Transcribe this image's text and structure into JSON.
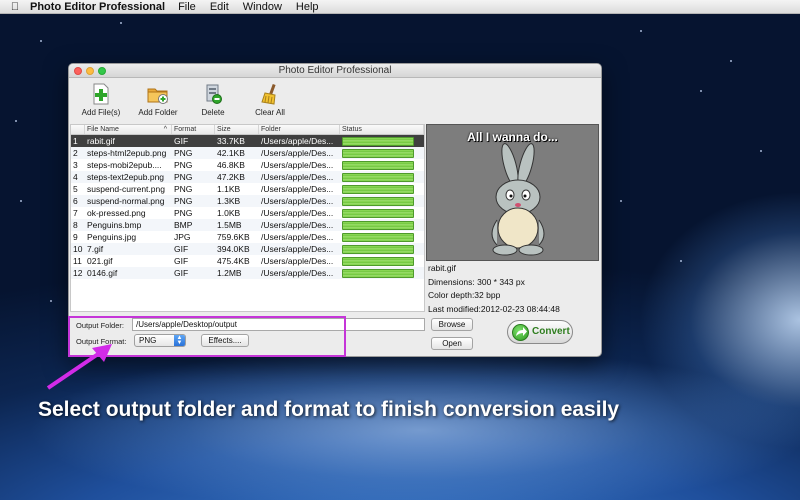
{
  "menubar": {
    "apple_icon": "apple-icon",
    "app_name": "Photo Editor Professional",
    "items": [
      "File",
      "Edit",
      "Window",
      "Help"
    ]
  },
  "window": {
    "title": "Photo Editor Professional"
  },
  "toolbar": {
    "add_files_label": "Add File(s)",
    "add_folder_label": "Add Folder",
    "delete_label": "Delete",
    "clear_all_label": "Clear All"
  },
  "file_table": {
    "columns": [
      "File Name",
      "Format",
      "Size",
      "Folder",
      "Status"
    ],
    "sort_indicator": "^",
    "rows": [
      {
        "num": "1",
        "name": "rabit.gif",
        "format": "GIF",
        "size": "33.7KB",
        "folder": "/Users/apple/Des...",
        "progress": 1.0
      },
      {
        "num": "2",
        "name": "steps-html2epub.png",
        "format": "PNG",
        "size": "42.1KB",
        "folder": "/Users/apple/Des...",
        "progress": 1.0
      },
      {
        "num": "3",
        "name": "steps-mobi2epub....",
        "format": "PNG",
        "size": "46.8KB",
        "folder": "/Users/apple/Des...",
        "progress": 1.0
      },
      {
        "num": "4",
        "name": "steps-text2epub.png",
        "format": "PNG",
        "size": "47.2KB",
        "folder": "/Users/apple/Des...",
        "progress": 1.0
      },
      {
        "num": "5",
        "name": "suspend-current.png",
        "format": "PNG",
        "size": "1.1KB",
        "folder": "/Users/apple/Des...",
        "progress": 1.0
      },
      {
        "num": "6",
        "name": "suspend-normal.png",
        "format": "PNG",
        "size": "1.3KB",
        "folder": "/Users/apple/Des...",
        "progress": 1.0
      },
      {
        "num": "7",
        "name": "ok-pressed.png",
        "format": "PNG",
        "size": "1.0KB",
        "folder": "/Users/apple/Des...",
        "progress": 1.0
      },
      {
        "num": "8",
        "name": "Penguins.bmp",
        "format": "BMP",
        "size": "1.5MB",
        "folder": "/Users/apple/Des...",
        "progress": 1.0
      },
      {
        "num": "9",
        "name": "Penguins.jpg",
        "format": "JPG",
        "size": "759.6KB",
        "folder": "/Users/apple/Des...",
        "progress": 1.0
      },
      {
        "num": "10",
        "name": "7.gif",
        "format": "GIF",
        "size": "394.0KB",
        "folder": "/Users/apple/Des...",
        "progress": 1.0
      },
      {
        "num": "11",
        "name": "021.gif",
        "format": "GIF",
        "size": "475.4KB",
        "folder": "/Users/apple/Des...",
        "progress": 1.0
      },
      {
        "num": "12",
        "name": "0146.gif",
        "format": "GIF",
        "size": "1.2MB",
        "folder": "/Users/apple/Des...",
        "progress": 1.0
      }
    ],
    "selected_row": 0
  },
  "preview": {
    "caption": "All I wanna do...",
    "filename": "rabit.gif",
    "dimensions": "Dimensions: 300 * 343 px",
    "color_depth": "Color depth:32 bpp",
    "last_modified": "Last modified:2012-02-23 08:44:48"
  },
  "output": {
    "folder_label": "Output Folder:",
    "folder_value": "/Users/apple/Desktop/output",
    "format_label": "Output Format:",
    "format_value": "PNG",
    "effects_label": "Effects....",
    "browse_label": "Browse",
    "open_label": "Open",
    "convert_label": "Convert"
  },
  "annotation": {
    "headline": "Select output folder and format to finish conversion easily",
    "highlight_color": "#c535d8"
  },
  "colors": {
    "progress_green": "#6fc43e",
    "selected_row": "#3f3f3f",
    "convert_text": "#2e7d1e"
  }
}
